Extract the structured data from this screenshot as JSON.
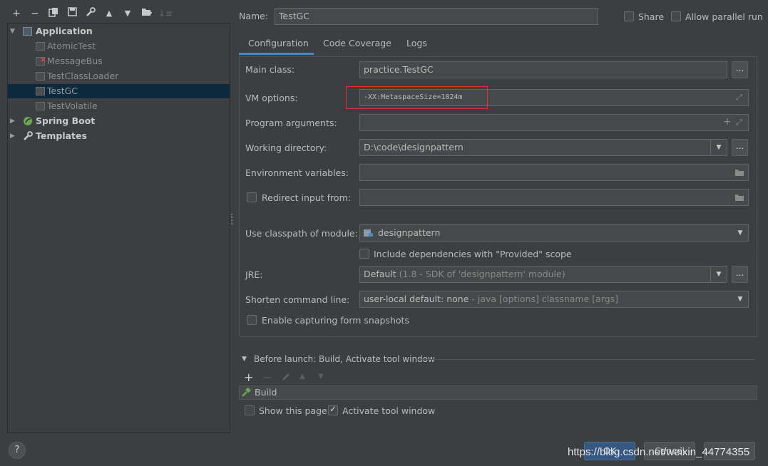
{
  "toolbar": {
    "icons": [
      "add-icon",
      "remove-icon",
      "copy-icon",
      "save-icon",
      "wrench-icon",
      "move-up-icon",
      "move-down-icon",
      "folder-add-icon",
      "sort-icon"
    ]
  },
  "tree": {
    "application": {
      "label": "Application"
    },
    "items": [
      {
        "label": "AtomicTest"
      },
      {
        "label": "MessageBus"
      },
      {
        "label": "TestClassLoader"
      },
      {
        "label": "TestGC"
      },
      {
        "label": "TestVolatile"
      }
    ],
    "spring_boot": {
      "label": "Spring Boot"
    },
    "templates": {
      "label": "Templates"
    }
  },
  "header": {
    "name_label": "Name:",
    "name_value": "TestGC",
    "share_label": "Share",
    "allow_parallel_label": "Allow parallel run"
  },
  "tabs": [
    {
      "label": "Configuration",
      "active": true
    },
    {
      "label": "Code Coverage"
    },
    {
      "label": "Logs"
    }
  ],
  "form": {
    "main_class_label": "Main class:",
    "main_class_value": "practice.TestGC",
    "dots": "...",
    "vm_options_label": "VM options:",
    "vm_options_value": "-XX:MetaspaceSize=1024m",
    "program_args_label": "Program arguments:",
    "working_dir_label": "Working directory:",
    "working_dir_value": "D:\\code\\designpattern",
    "env_vars_label": "Environment variables:",
    "redirect_label": "Redirect input from:",
    "classpath_label": "Use classpath of module:",
    "classpath_value": "designpattern",
    "include_deps_label": "Include dependencies with \"Provided\" scope",
    "jre_label": "JRE:",
    "jre_value_main": "Default",
    "jre_value_detail": "(1.8 - SDK of 'designpattern' module)",
    "shorten_label": "Shorten command line:",
    "shorten_value_main": "user-local default: none",
    "shorten_value_detail": " - java [options] classname [args]",
    "snapshots_label": "Enable capturing form snapshots"
  },
  "before_launch": {
    "title": "Before launch: Build, Activate tool window",
    "items": [
      {
        "label": "Build"
      }
    ],
    "show_page_label": "Show this page",
    "activate_label": "Activate tool window"
  },
  "footer": {
    "help": "?",
    "ok": "OK",
    "cancel": "Cancel",
    "watermark": "https://blog.csdn.net/weixin_44774355"
  },
  "colors": {
    "background": "#3c3f41",
    "selection": "#0d293e",
    "accent_tab": "#4a88c7",
    "highlight_box": "#e0312f",
    "ok_button": "#365880"
  }
}
